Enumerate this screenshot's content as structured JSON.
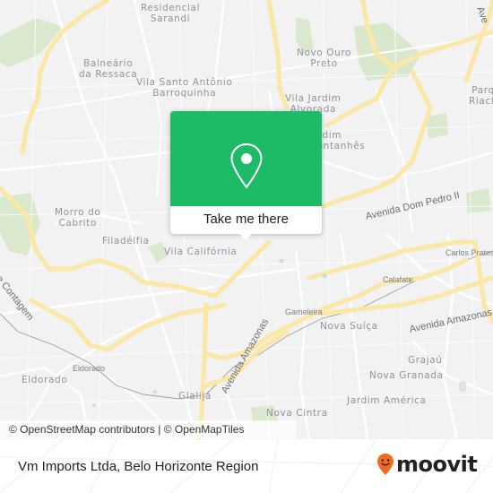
{
  "map": {
    "neighborhoods": [
      {
        "id": "residencial-sarandi",
        "text": "Residencial\nSarandi"
      },
      {
        "id": "balneario-da-ressaca",
        "text": "Balneário\nda Ressaca"
      },
      {
        "id": "vila-santo-antonio-barroquinha",
        "text": "Vila Santo Antônio\nBarroquinha"
      },
      {
        "id": "novo-ouro-preto",
        "text": "Novo Ouro\nPreto"
      },
      {
        "id": "vila-jardim-alvorada",
        "text": "Vila Jardim\nAlvorada"
      },
      {
        "id": "jardim-montanhes",
        "text": "Jardim\nMontanhês"
      },
      {
        "id": "parque-riachuelo",
        "text": "Parq\nRiach"
      },
      {
        "id": "morro-do-cabrito",
        "text": "Morro do\nCabrito"
      },
      {
        "id": "filadelfia",
        "text": "Filadélfia"
      },
      {
        "id": "vila-california",
        "text": "Vila Califórnia"
      },
      {
        "id": "eldorado-district",
        "text": "Eldorado"
      },
      {
        "id": "glalija",
        "text": "Glalijá"
      },
      {
        "id": "nova-suica",
        "text": "Nova Suíça"
      },
      {
        "id": "grajau",
        "text": "Grajaú"
      },
      {
        "id": "nova-granada",
        "text": "Nova Granada"
      },
      {
        "id": "jardim-america",
        "text": "Jardim América"
      },
      {
        "id": "nova-cintra",
        "text": "Nova Cintra"
      }
    ],
    "stations": [
      {
        "id": "eldorado-station",
        "text": "Eldorado"
      },
      {
        "id": "gameleira",
        "text": "Gameleira"
      },
      {
        "id": "calafate",
        "text": "Calafate"
      },
      {
        "id": "carlos-prates",
        "text": "Carlos Prates"
      }
    ],
    "roads": [
      {
        "id": "avenida-dom-pedro-ii",
        "text": "Avenida Dom Pedro II"
      },
      {
        "id": "avenida-amazonas-east",
        "text": "Avenida Amazonas"
      },
      {
        "id": "avenida-amazonas-south",
        "text": "Avenida Amazonas"
      },
      {
        "id": "via-contagem",
        "text": "e Contagem"
      },
      {
        "id": "ave-north",
        "text": "Ave"
      }
    ],
    "attribution": "© OpenStreetMap contributors | © OpenMapTiles"
  },
  "popup": {
    "button_label": "Take me there",
    "accent_color": "#1dba68"
  },
  "footer": {
    "title": "Vm Imports Ltda, Belo Horizonte Region",
    "logo_text": "moovit",
    "logo_color": "#f26b21"
  }
}
